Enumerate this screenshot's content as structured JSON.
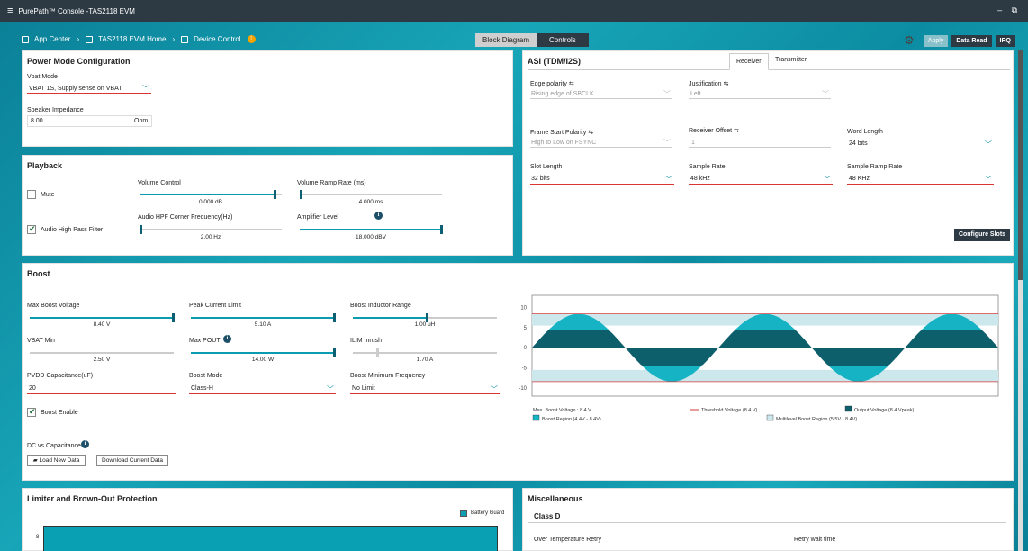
{
  "window": {
    "title": "PurePath™ Console -TAS2118 EVM",
    "controls": "– ⧉"
  },
  "breadcrumb": {
    "app_center": "App Center",
    "evm_home": "TAS2118 EVM Home",
    "device_control": "Device Control",
    "sep": "›",
    "warn": "!"
  },
  "view_tabs": {
    "block_diagram": "Block Diagram",
    "controls": "Controls"
  },
  "toolbar": {
    "apply": "Apply",
    "data_read": "Data Read",
    "irq": "IRQ"
  },
  "power_mode": {
    "title": "Power Mode Configuration",
    "vbat_mode_label": "Vbat Mode",
    "vbat_mode_value": "VBAT 1S, Supply sense on VBAT",
    "spk_imp_label": "Speaker Impedance",
    "spk_imp_value": "8.00",
    "spk_imp_unit": "Ohm"
  },
  "playback": {
    "title": "Playback",
    "mute_label": "Mute",
    "hpf_label": "Audio High Pass Filter",
    "volume_label": "Volume Control",
    "volume_value": "0.000 dB",
    "ramp_label": "Volume Ramp Rate (ms)",
    "ramp_value": "4.000 ms",
    "hpf_freq_label": "Audio HPF Corner Frequency(Hz)",
    "hpf_freq_value": "2.00 Hz",
    "amp_level_label": "Amplifier Level",
    "amp_level_value": "18.000 dBV",
    "info": "i"
  },
  "asi": {
    "title": "ASI (TDM/I2S)",
    "tabs": [
      "Receiver",
      "Transmitter"
    ],
    "edge_label": "Edge polarity",
    "edge_value": "Rising edge of SBCLK",
    "just_label": "Justification",
    "just_value": "Left",
    "fs_pol_label": "Frame Start Polarity",
    "fs_pol_value": "High to Low on FSYNC",
    "rx_off_label": "Receiver Offset",
    "rx_off_value": "1",
    "word_len_label": "Word Length",
    "word_len_value": "24 bits",
    "slot_len_label": "Slot Length",
    "slot_len_value": "32 bits",
    "sample_rate_label": "Sample Rate",
    "sample_rate_value": "48 kHz",
    "sample_ramp_label": "Sample Ramp Rate",
    "sample_ramp_value": "48 KHz",
    "configure_slots": "Configure Slots",
    "usb": "⇆"
  },
  "boost": {
    "title": "Boost",
    "max_boost_label": "Max Boost Voltage",
    "max_boost_value": "8.40 V",
    "peak_label": "Peak Current Limit",
    "peak_value": "5.10 A",
    "inductor_label": "Boost Inductor Range",
    "inductor_value": "1.00 uH",
    "vbat_min_label": "VBAT Min",
    "vbat_min_value": "2.50 V",
    "max_pout_label": "Max POUT",
    "max_pout_value": "14.00 W",
    "ilim_label": "ILIM Inrush",
    "ilim_value": "1.70 A",
    "pvdd_label": "PVDD Capacitance(uF)",
    "pvdd_value": "20",
    "mode_label": "Boost Mode",
    "mode_value": "Class-H",
    "minfreq_label": "Boost Minimum Frequency",
    "minfreq_value": "No Limit",
    "enable_label": "Boost Enable",
    "dc_cap_label": "DC vs Capacitance",
    "load_btn": "Load New Data",
    "download_btn": "Download Current Data",
    "slider_fractions": {
      "max_boost": 0.82,
      "peak": 1.0,
      "inductor": 0.52,
      "vbat_min": 0.0,
      "max_pout": 1.0,
      "ilim": 0.16
    }
  },
  "limiter": {
    "title": "Limiter and Brown-Out Protection",
    "legend": "Battery Guard",
    "tick": "8"
  },
  "misc": {
    "title": "Miscellaneous",
    "section": "Class D",
    "otr_label": "Over Temperature Retry",
    "retry_label": "Retry wait time"
  },
  "colors": {
    "output": "#0d5f6c",
    "boost_region": "#16b3c4",
    "multilevel": "#cde8ed",
    "threshold": "#d13a3a",
    "accent": "#0a9bb0"
  },
  "chart_data": {
    "type": "area",
    "yticks": [
      "10",
      "5",
      "0",
      "-5",
      "-10"
    ],
    "ylim": [
      -12,
      13
    ],
    "legend": {
      "max_boost": "Max. Boost Voltage : 8.4 V",
      "threshold": "Threshold Voltage (8.4 V)",
      "output": "Output Voltage (8.4 Vpeak)",
      "boost_region": "Boost Region (4.4V - 8.4V)",
      "multilevel": "Multilevel Boost Region (5.5V - 8.4V)"
    },
    "threshold": 8.4,
    "output_peak": 8.4,
    "boost_region": [
      4.4,
      8.4
    ],
    "multilevel_region": [
      5.5,
      8.4
    ],
    "cycles": 2.5
  }
}
